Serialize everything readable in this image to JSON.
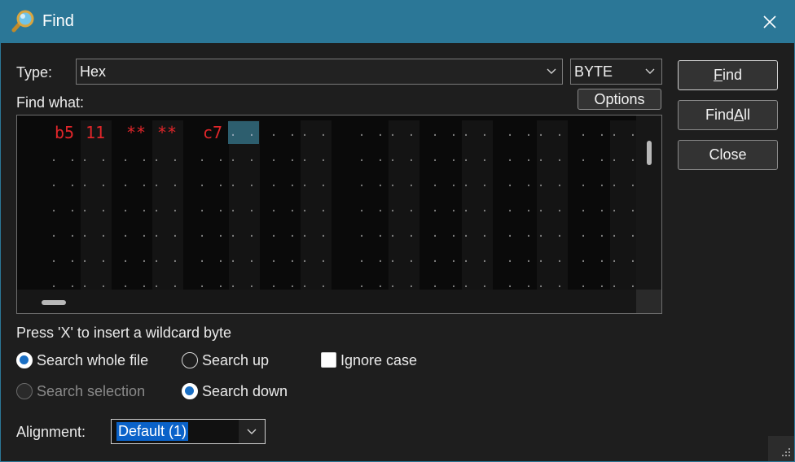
{
  "window": {
    "title": "Find",
    "title_bar_color": "#2b7797",
    "icon": "magnifier-icon",
    "close_icon": "close-icon"
  },
  "type_row": {
    "label": "Type:",
    "type_value": "Hex",
    "width_value": "BYTE"
  },
  "find_what": {
    "label": "Find what:",
    "options_label": "Options",
    "hex_values": [
      "b5",
      "11",
      "**",
      "**",
      "c7"
    ],
    "empty_cell": ". .",
    "value_color": "#e0262a"
  },
  "buttons": {
    "find": {
      "pre": "",
      "ul": "F",
      "post": "ind"
    },
    "find_all": {
      "pre": "Find ",
      "ul": "A",
      "post": "ll"
    },
    "close": {
      "pre": "",
      "ul": "",
      "post": "Close"
    }
  },
  "hint": "Press 'X' to insert a wildcard byte",
  "options": {
    "search_whole_file": {
      "label": "Search whole file",
      "checked": true
    },
    "search_up": {
      "label": "Search up",
      "checked": false
    },
    "ignore_case": {
      "label": "Ignore case",
      "checked": false
    },
    "search_selection": {
      "label": "Search selection",
      "checked": false,
      "disabled": true
    },
    "search_down": {
      "label": "Search down",
      "checked": true
    }
  },
  "alignment": {
    "label": "Alignment:",
    "value": "Default (1)"
  }
}
